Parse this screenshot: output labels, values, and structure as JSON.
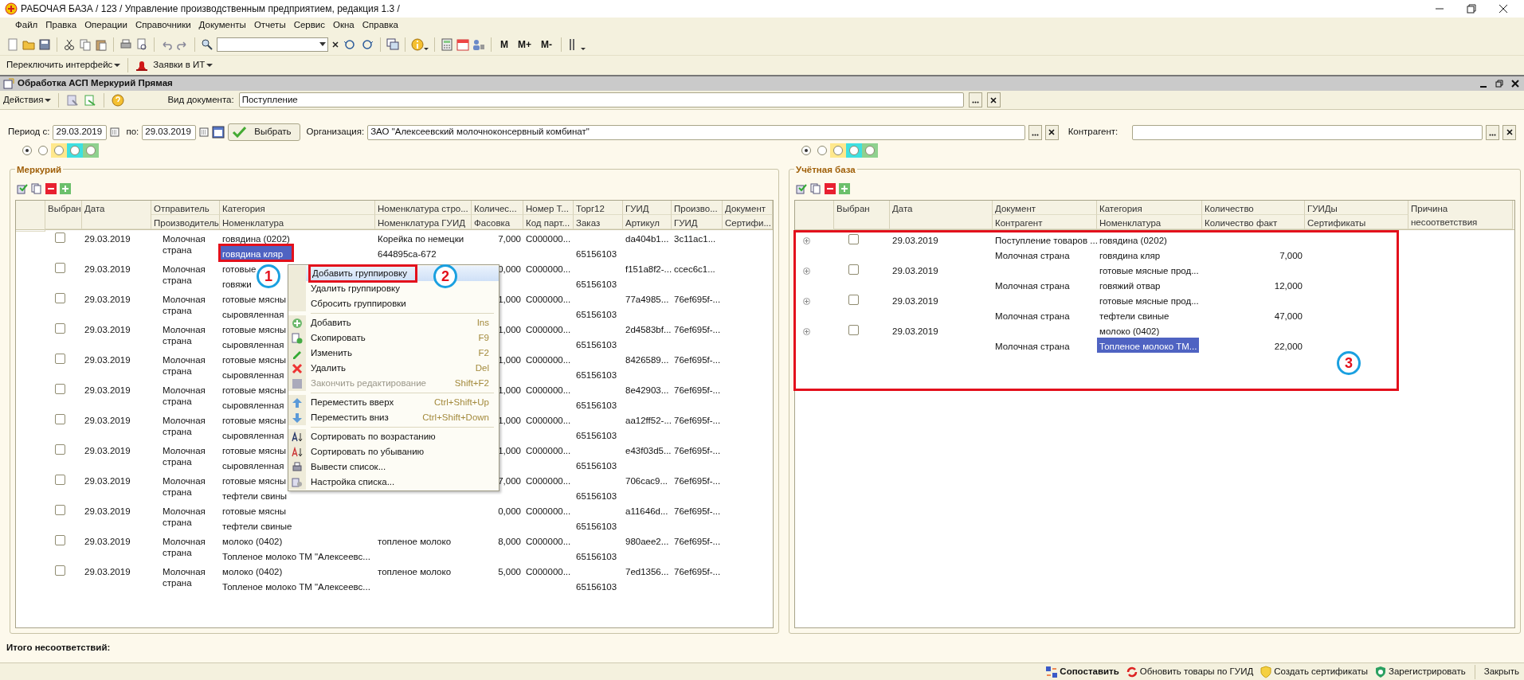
{
  "window": {
    "title": "РАБОЧАЯ БАЗА / 123 /  Управление производственным предприятием, редакция 1.3 /"
  },
  "menu": [
    "Файл",
    "Правка",
    "Операции",
    "Справочники",
    "Документы",
    "Отчеты",
    "Сервис",
    "Окна",
    "Справка"
  ],
  "toolbar": {
    "memory_buttons": [
      "M",
      "M+",
      "M-"
    ]
  },
  "toolbar2": [
    "Переключить интерфейс",
    "Заявки в ИТ"
  ],
  "document_window": {
    "title": "Обработка  АСП Меркурий Прямая",
    "actions": "Действия",
    "doc_type_label": "Вид документа:",
    "doc_type": "Поступление"
  },
  "period": {
    "from_label": "Период с:",
    "from": "29.03.2019",
    "to_label": "по:",
    "to": "29.03.2019",
    "select_button": "Выбрать",
    "org_label": "Организация:",
    "org": "ЗАО \"Алексеевский молочноконсервный комбинат\"",
    "counterparty_label": "Контрагент:"
  },
  "filters_left": [
    {
      "selected": true
    },
    {
      "selected": false
    },
    {
      "selected": false,
      "color": "#ffe88c"
    },
    {
      "selected": false,
      "color": "#3ee0e0"
    },
    {
      "selected": false,
      "color": "#8fd18f"
    }
  ],
  "filters_right": [
    {
      "selected": true
    },
    {
      "selected": false
    },
    {
      "selected": false,
      "color": "#ffe88c"
    },
    {
      "selected": false,
      "color": "#3ee0e0"
    },
    {
      "selected": false,
      "color": "#8fd18f"
    }
  ],
  "mercury": {
    "title": "Меркурий",
    "columns": [
      {
        "top": "Выбран"
      },
      {
        "top": "Дата"
      },
      {
        "top": "Отправитель",
        "bottom": "Производитель"
      },
      {
        "top": "Категория",
        "bottom": "Номенклатура"
      },
      {
        "top": "Номенклатура стро...",
        "bottom": "Номенклатура ГУИД"
      },
      {
        "top": "Количес...",
        "bottom": "Фасовка"
      },
      {
        "top": "Номер Т...",
        "bottom": "Код парт..."
      },
      {
        "top": "Торг12",
        "bottom": "Заказ"
      },
      {
        "top": "ГУИД",
        "bottom": "Артикул"
      },
      {
        "top": "Произво...",
        "bottom": "ГУИД"
      },
      {
        "top": "Документ",
        "bottom": "Сертифи..."
      }
    ],
    "rows": [
      {
        "checked": false,
        "selected": true,
        "date": "29.03.2019",
        "sender": "Молочная страна",
        "category": "говядина (0202)",
        "nomenclature": "говядина кляр",
        "nom_line": "Корейка по немецки",
        "nom_guid": "644895ca-672",
        "qty": "7,000",
        "number": "C000000...",
        "order": "65156103",
        "guid": "da404b1...",
        "prod_guid": "3c11ac1..."
      },
      {
        "checked": false,
        "selected": false,
        "date": "29.03.2019",
        "sender": "Молочная страна",
        "category": "готовые",
        "nomenclature": "говяжи",
        "qty": "0,000",
        "number": "C000000...",
        "order": "65156103",
        "guid": "f151a8f2-...",
        "prod_guid": "ccec6c1..."
      },
      {
        "checked": false,
        "selected": false,
        "date": "29.03.2019",
        "sender": "Молочная страна",
        "category": "готовые мясны",
        "nomenclature": "сыровяленная",
        "qty": "1,000",
        "number": "C000000...",
        "order": "65156103",
        "guid": "77a4985...",
        "prod_guid": "76ef695f-..."
      },
      {
        "checked": false,
        "selected": false,
        "date": "29.03.2019",
        "sender": "Молочная страна",
        "category": "готовые мясны",
        "nomenclature": "сыровяленная",
        "qty": "1,000",
        "number": "C000000...",
        "order": "65156103",
        "guid": "2d4583bf...",
        "prod_guid": "76ef695f-..."
      },
      {
        "checked": false,
        "selected": false,
        "date": "29.03.2019",
        "sender": "Молочная страна",
        "category": "готовые мясны",
        "nomenclature": "сыровяленная",
        "qty": "1,000",
        "number": "C000000...",
        "order": "65156103",
        "guid": "8426589...",
        "prod_guid": "76ef695f-..."
      },
      {
        "checked": false,
        "selected": false,
        "date": "29.03.2019",
        "sender": "Молочная страна",
        "category": "готовые мясны",
        "nomenclature": "сыровяленная",
        "qty": "1,000",
        "number": "C000000...",
        "order": "65156103",
        "guid": "8e42903...",
        "prod_guid": "76ef695f-..."
      },
      {
        "checked": false,
        "selected": false,
        "date": "29.03.2019",
        "sender": "Молочная страна",
        "category": "готовые мясны",
        "nomenclature": "сыровяленная",
        "qty": "1,000",
        "number": "C000000...",
        "order": "65156103",
        "guid": "aa12ff52-...",
        "prod_guid": "76ef695f-..."
      },
      {
        "checked": false,
        "selected": false,
        "date": "29.03.2019",
        "sender": "Молочная страна",
        "category": "готовые мясны",
        "nomenclature": "сыровяленная",
        "qty": "1,000",
        "number": "C000000...",
        "order": "65156103",
        "guid": "e43f03d5...",
        "prod_guid": "76ef695f-..."
      },
      {
        "checked": false,
        "selected": false,
        "date": "29.03.2019",
        "sender": "Молочная страна",
        "category": "готовые мясны",
        "nomenclature": "тефтели свины",
        "qty": "7,000",
        "number": "C000000...",
        "order": "65156103",
        "guid": "706cac9...",
        "prod_guid": "76ef695f-..."
      },
      {
        "checked": false,
        "selected": false,
        "date": "29.03.2019",
        "sender": "Молочная страна",
        "category": "готовые мясны",
        "nomenclature": "тефтели свиные",
        "qty": "0,000",
        "number": "C000000...",
        "order": "65156103",
        "guid": "a11646d...",
        "prod_guid": "76ef695f-..."
      },
      {
        "checked": false,
        "selected": false,
        "date": "29.03.2019",
        "sender": "Молочная страна",
        "category": "молоко (0402)",
        "nomenclature": "Топленое молоко  ТМ \"Алексеевс...",
        "nom_line": "топленое молоко",
        "qty": "8,000",
        "number": "C000000...",
        "order": "65156103",
        "guid": "980aee2...",
        "prod_guid": "76ef695f-..."
      },
      {
        "checked": false,
        "selected": false,
        "date": "29.03.2019",
        "sender": "Молочная страна",
        "category": "молоко (0402)",
        "nomenclature": "Топленое молоко  ТМ \"Алексеевс...",
        "nom_line": "топленое молоко",
        "qty": "5,000",
        "number": "C000000...",
        "order": "65156103",
        "guid": "7ed1356...",
        "prod_guid": "76ef695f-..."
      }
    ]
  },
  "context_menu": [
    {
      "kind": "item",
      "label": "Добавить группировку",
      "selected": true,
      "disabled": false
    },
    {
      "kind": "item",
      "label": "Удалить группировку",
      "selected": false,
      "disabled": false
    },
    {
      "kind": "item",
      "label": "Сбросить группировки",
      "selected": false,
      "disabled": false
    },
    {
      "kind": "separator"
    },
    {
      "kind": "item",
      "label": "Добавить",
      "shortcut": "Ins",
      "selected": false,
      "disabled": false
    },
    {
      "kind": "item",
      "label": "Скопировать",
      "shortcut": "F9",
      "selected": false,
      "disabled": false
    },
    {
      "kind": "item",
      "label": "Изменить",
      "shortcut": "F2",
      "selected": false,
      "disabled": false
    },
    {
      "kind": "item",
      "label": "Удалить",
      "shortcut": "Del",
      "selected": false,
      "disabled": false
    },
    {
      "kind": "item",
      "label": "Закончить редактирование",
      "shortcut": "Shift+F2",
      "selected": false,
      "disabled": true
    },
    {
      "kind": "separator"
    },
    {
      "kind": "item",
      "label": "Переместить вверх",
      "shortcut": "Ctrl+Shift+Up",
      "selected": false,
      "disabled": false
    },
    {
      "kind": "item",
      "label": "Переместить вниз",
      "shortcut": "Ctrl+Shift+Down",
      "selected": false,
      "disabled": false
    },
    {
      "kind": "separator"
    },
    {
      "kind": "item",
      "label": "Сортировать по возрастанию",
      "selected": false,
      "disabled": false
    },
    {
      "kind": "item",
      "label": "Сортировать по убыванию",
      "selected": false,
      "disabled": false
    },
    {
      "kind": "item",
      "label": "Вывести список...",
      "selected": false,
      "disabled": false
    },
    {
      "kind": "item",
      "label": "Настройка списка...",
      "selected": false,
      "disabled": false
    }
  ],
  "accounting": {
    "title": "Учётная база",
    "columns": [
      {
        "top": "Выбран"
      },
      {
        "top": "Дата"
      },
      {
        "top": "Документ",
        "bottom": "Контрагент"
      },
      {
        "top": "Категория",
        "bottom": "Номенклатура"
      },
      {
        "top": "Количество",
        "bottom": "Количество факт"
      },
      {
        "top": "ГУИДы",
        "bottom": "Сертификаты"
      },
      {
        "top": "Причина несоответствия"
      }
    ],
    "rows": [
      {
        "checked": false,
        "selected": false,
        "date": "29.03.2019",
        "document": "Поступление товаров ...",
        "counterparty": "Молочная страна",
        "category": "говядина (0202)",
        "nomenclature": "говядина кляр",
        "qty": "7,000"
      },
      {
        "checked": false,
        "selected": false,
        "date": "29.03.2019",
        "counterparty": "Молочная страна",
        "category": "готовые мясные прод...",
        "nomenclature": "говяжий отвар",
        "qty": "12,000"
      },
      {
        "checked": false,
        "selected": false,
        "date": "29.03.2019",
        "counterparty": "Молочная страна",
        "category": "готовые мясные прод...",
        "nomenclature": "тефтели свиные",
        "qty": "47,000"
      },
      {
        "checked": false,
        "selected": true,
        "date": "29.03.2019",
        "counterparty": "Молочная страна",
        "category": "молоко (0402)",
        "nomenclature": "Топленое молоко  ТМ...",
        "qty": "22,000"
      }
    ]
  },
  "total_label": "Итого несоответствий:",
  "bottom_buttons": [
    {
      "label": "Сопоставить",
      "bold": true
    },
    {
      "label": "Обновить товары по ГУИД",
      "bold": false
    },
    {
      "label": "Создать сертификаты",
      "bold": false
    },
    {
      "label": "Зарегистрировать",
      "bold": false
    },
    {
      "label": "Закрыть",
      "bold": false
    }
  ],
  "annotations": [
    "1",
    "2",
    "3"
  ]
}
